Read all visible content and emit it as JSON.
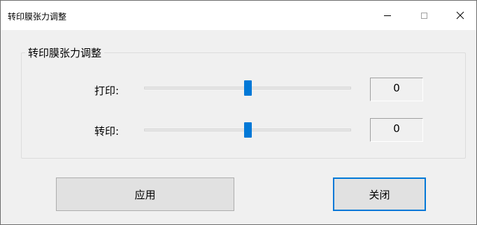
{
  "window": {
    "title": "转印膜张力调整"
  },
  "group": {
    "title": "转印膜张力调整"
  },
  "rows": [
    {
      "label": "打印:",
      "value": "0",
      "slider_fraction": 0.5
    },
    {
      "label": "转印:",
      "value": "0",
      "slider_fraction": 0.5
    }
  ],
  "buttons": {
    "apply": "应用",
    "close": "关闭"
  },
  "colors": {
    "accent": "#0078d7",
    "window_bg": "#f0f0f0",
    "titlebar_bg": "#ffffff",
    "button_bg": "#e1e1e1"
  },
  "icons": {
    "minimize": "minimize-icon",
    "maximize": "maximize-icon",
    "close": "close-icon"
  }
}
